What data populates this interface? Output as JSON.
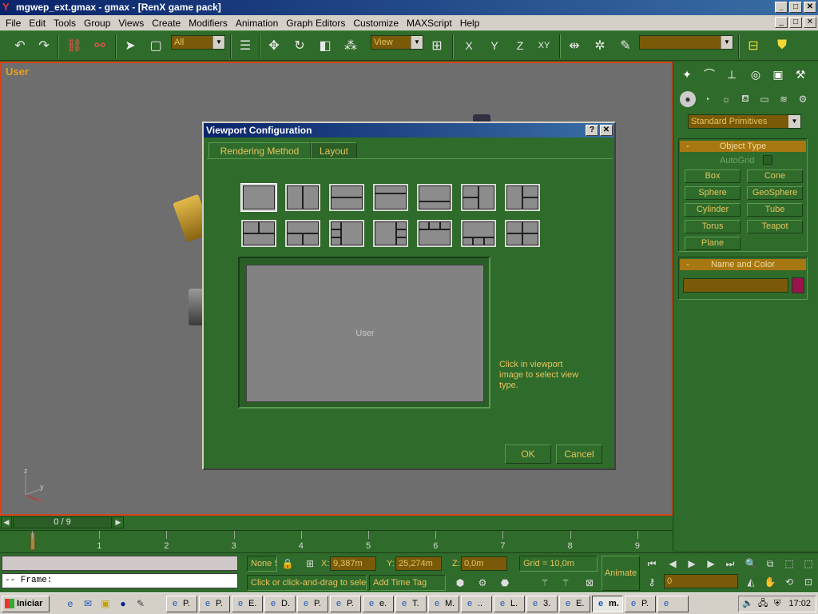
{
  "window": {
    "title": "mgwep_ext.gmax - gmax - [RenX game pack]",
    "app_icon": "gmax-icon",
    "buttons": [
      "_",
      "□",
      "✕"
    ]
  },
  "menubar": {
    "items": [
      "File",
      "Edit",
      "Tools",
      "Group",
      "Views",
      "Create",
      "Modifiers",
      "Animation",
      "Graph Editors",
      "Customize",
      "MAXScript",
      "Help"
    ],
    "buttons": [
      "_",
      "□",
      "✕"
    ]
  },
  "toolbar": {
    "selection_filter": "All",
    "reference_coord": "View",
    "axis_buttons": [
      "X",
      "Y",
      "Z",
      "XY"
    ],
    "named_selection": ""
  },
  "viewport": {
    "label": "User",
    "axes": {
      "x": "x",
      "y": "y",
      "z": "z"
    }
  },
  "command_panel": {
    "category": "Standard Primitives",
    "object_type": {
      "header": "Object Type",
      "autogrid_label": "AutoGrid",
      "buttons": [
        "Box",
        "Cone",
        "Sphere",
        "GeoSphere",
        "Cylinder",
        "Tube",
        "Torus",
        "Teapot",
        "Plane"
      ]
    },
    "name_and_color": {
      "header": "Name and Color",
      "name_value": "",
      "color": "#99134f"
    }
  },
  "timeline": {
    "slider_label": "0 / 9",
    "ticks": [
      "1",
      "2",
      "3",
      "4",
      "5",
      "6",
      "7",
      "8",
      "9"
    ]
  },
  "status": {
    "listener_top": "",
    "listener_bottom": "-- Frame:",
    "selection": "None S",
    "x_label": "X:",
    "x_value": "9,387m",
    "y_label": "Y:",
    "y_value": "25,274m",
    "z_label": "Z:",
    "z_value": "0,0m",
    "grid": "Grid = 10,0m",
    "prompt": "Click or click-and-drag to select objects",
    "add_time_tag": "Add Time Tag",
    "animate": "Animate",
    "current_frame": "0"
  },
  "dialog": {
    "title": "Viewport Configuration",
    "title_buttons": [
      "?",
      "✕"
    ],
    "tabs": [
      "Rendering Method",
      "Layout"
    ],
    "active_tab": "Layout",
    "preview_label": "User",
    "hint": "Click in viewport image to select view type.",
    "ok_label": "OK",
    "cancel_label": "Cancel"
  },
  "taskbar": {
    "start_label": "Iniciar",
    "tasks": [
      "P.",
      "P.",
      "E.",
      "D.",
      "P.",
      "P.",
      "e.",
      "T.",
      "M.",
      "..",
      "L.",
      "3.",
      "E.",
      "m.",
      "P.",
      ""
    ],
    "active_task_index": 13,
    "clock": "17:02"
  }
}
